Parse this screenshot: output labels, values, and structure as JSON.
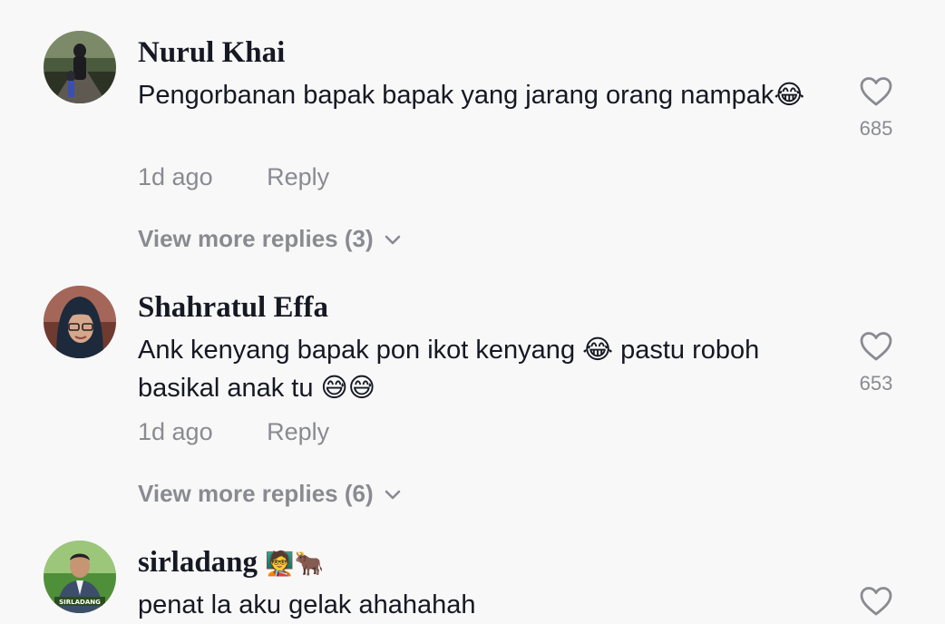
{
  "comments": [
    {
      "username": "Nurul Khai",
      "text": "Pengorbanan bapak bapak yang jarang orang nampak😂",
      "time": "1d ago",
      "reply_label": "Reply",
      "view_more": "View more replies (3)",
      "like_count": "685"
    },
    {
      "username": "Shahratul Effa",
      "text": "Ank kenyang bapak pon ikot kenyang 😂 pastu roboh basikal anak tu 😅😅",
      "time": "1d ago",
      "reply_label": "Reply",
      "view_more": "View more replies (6)",
      "like_count": "653"
    },
    {
      "username": "sirladang",
      "username_emojis": "🧑‍🏫🐂",
      "text": "penat la aku gelak ahahahah"
    }
  ],
  "avatar_badge_text": "SIRLADANG",
  "icons": {
    "like": "heart-outline-icon",
    "expand": "chevron-down-icon"
  },
  "colors": {
    "background": "#f8f8f8",
    "primary_text": "#161823",
    "secondary_text": "#8a8b91"
  }
}
